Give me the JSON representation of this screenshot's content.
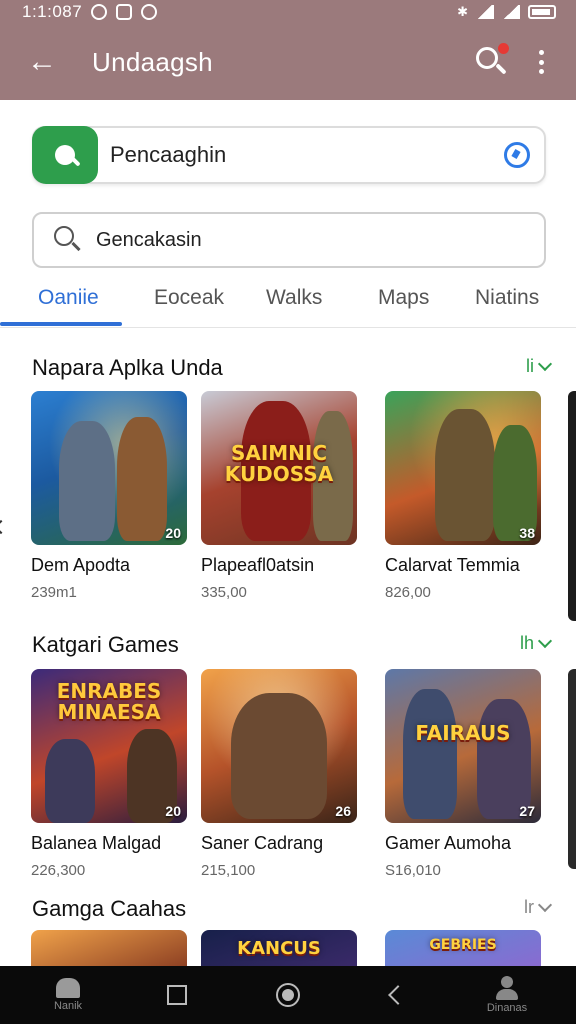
{
  "status_bar": {
    "time": "1:1:087",
    "icons": [
      "settings-icon",
      "media-icon",
      "game-icon",
      "bluetooth-icon",
      "signal-icon",
      "battery-icon"
    ]
  },
  "app_bar": {
    "title": "Undaagsh",
    "icons": [
      "back-arrow-icon",
      "search-icon",
      "more-vert-icon"
    ],
    "notification_color": "#e53935",
    "color": "#9b7a7c"
  },
  "location_field": {
    "value": "Pencaaghin",
    "icon": "map-pin-icon",
    "accent": "#2e9e4c"
  },
  "search": {
    "value": "Gencakasin",
    "icon": "search-icon"
  },
  "tabs": [
    {
      "label": "Oaniie",
      "active": true
    },
    {
      "label": "Eoceak",
      "active": false
    },
    {
      "label": "Walks",
      "active": false
    },
    {
      "label": "Maps",
      "active": false
    },
    {
      "label": "Niatins",
      "active": false
    }
  ],
  "sections": [
    {
      "title": "Napara Aplka Unda",
      "more_label": "li",
      "items": [
        {
          "name": "Dem Apodta",
          "meta": "239m1",
          "badge": "20",
          "logo": ""
        },
        {
          "name": "Plapeafl0atsin",
          "meta": "335,00",
          "badge": "",
          "logo": "SAIMNIC KUDOSSA"
        },
        {
          "name": "Calarvat Temmia",
          "meta": "826,00",
          "badge": "38",
          "logo": ""
        }
      ]
    },
    {
      "title": "Katgari Games",
      "more_label": "lh",
      "items": [
        {
          "name": "Balanea Malgad",
          "meta": "226,300",
          "badge": "20",
          "logo": "ENRABES MINAESA"
        },
        {
          "name": "Saner Cadrang",
          "meta": "215,100",
          "badge": "26",
          "logo": ""
        },
        {
          "name": "Gamer Aumoha",
          "meta": "S16,010",
          "badge": "27",
          "logo": "FAIRAUS"
        }
      ]
    },
    {
      "title": "Gamga Caahas",
      "more_label": "lr",
      "items": [
        {
          "name": "",
          "meta": "",
          "badge": "",
          "logo": ""
        },
        {
          "name": "",
          "meta": "",
          "badge": "",
          "logo": "KANCUS"
        },
        {
          "name": "",
          "meta": "",
          "badge": "",
          "logo": "GEBRIES"
        }
      ]
    }
  ],
  "nav_bar": {
    "home_label": "Nanik",
    "profile_label": "Dinanas"
  }
}
